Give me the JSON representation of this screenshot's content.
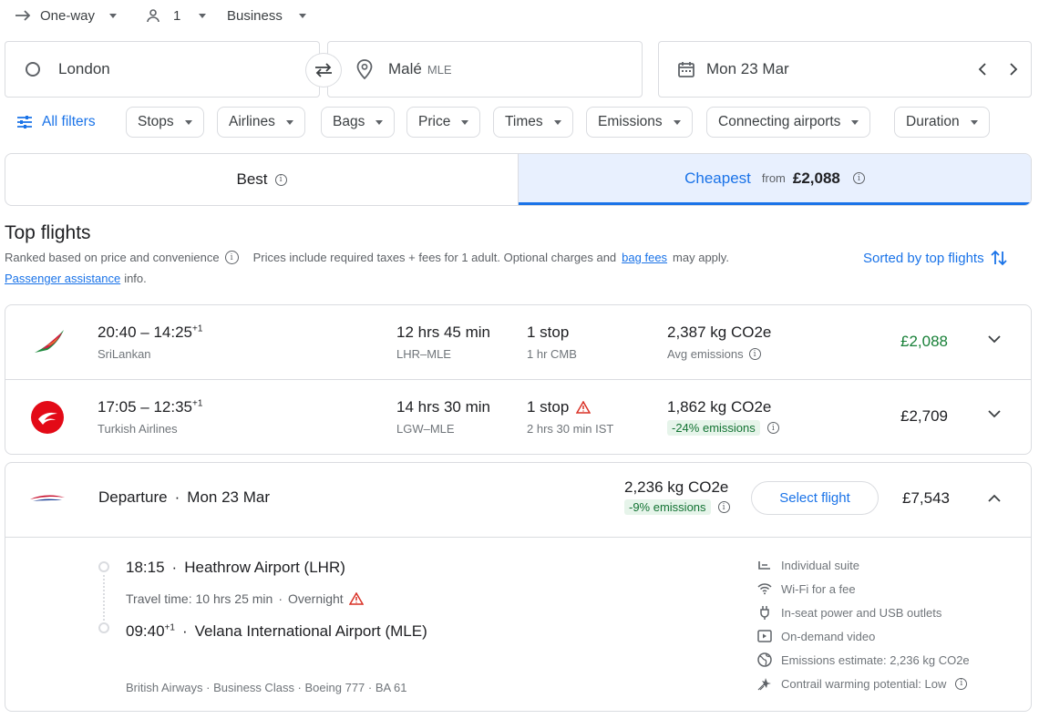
{
  "search": {
    "trip_type": "One-way",
    "passengers": "1",
    "cabin": "Business",
    "origin": "London",
    "destination": "Malé",
    "destination_code": "MLE",
    "date": "Mon 23 Mar"
  },
  "filters": {
    "all_filters": "All filters",
    "chips": [
      "Stops",
      "Airlines",
      "Bags",
      "Price",
      "Times",
      "Emissions",
      "Connecting airports",
      "Duration"
    ]
  },
  "tabs": {
    "best": "Best",
    "cheapest": "Cheapest",
    "cheapest_from": "from",
    "cheapest_price": "£2,088"
  },
  "section": {
    "title": "Top flights",
    "ranked": "Ranked based on price and convenience",
    "prices_note": "Prices include required taxes + fees for 1 adult. Optional charges and",
    "bag_fees": "bag fees",
    "may_apply": "may apply.",
    "passenger_assistance": "Passenger assistance",
    "info": "info.",
    "sorted": "Sorted by top flights"
  },
  "flights": [
    {
      "times": "20:40 – 14:25",
      "plus": "+1",
      "airline": "SriLankan",
      "duration": "12 hrs 45 min",
      "route": "LHR–MLE",
      "stops": "1 stop",
      "stop_detail": "1 hr CMB",
      "emissions": "2,387 kg CO2e",
      "emissions_note": "Avg emissions",
      "price": "£2,088",
      "price_color": "#188038"
    },
    {
      "times": "17:05 – 12:35",
      "plus": "+1",
      "airline": "Turkish Airlines",
      "duration": "14 hrs 30 min",
      "route": "LGW–MLE",
      "stops": "1 stop",
      "stop_detail": "2 hrs 30 min IST",
      "emissions": "1,862 kg CO2e",
      "emissions_note": "-24% emissions",
      "price": "£2,709",
      "price_color": "#202124"
    }
  ],
  "expanded": {
    "departure": "Departure",
    "date": "Mon 23 Mar",
    "emissions": "2,236 kg CO2e",
    "emissions_note": "-9% emissions",
    "select_button": "Select flight",
    "price": "£7,543",
    "dep_time": "18:15",
    "dep_airport": "Heathrow Airport (LHR)",
    "travel_time": "Travel time: 10 hrs 25 min",
    "overnight": "Overnight",
    "arr_time": "09:40",
    "arr_plus": "+1",
    "arr_airport": "Velana International Airport (MLE)",
    "details": "British Airways · Business Class · Boeing 777 · BA 61",
    "amenities": [
      {
        "icon": "seat-icon",
        "label": "Individual suite"
      },
      {
        "icon": "wifi-icon",
        "label": "Wi-Fi for a fee"
      },
      {
        "icon": "power-plug-icon",
        "label": "In-seat power and USB outlets"
      },
      {
        "icon": "video-icon",
        "label": "On-demand video"
      },
      {
        "icon": "globe-icon",
        "label": "Emissions estimate: 2,236 kg CO2e"
      },
      {
        "icon": "contrail-icon",
        "label": "Contrail warming potential: Low"
      }
    ]
  }
}
